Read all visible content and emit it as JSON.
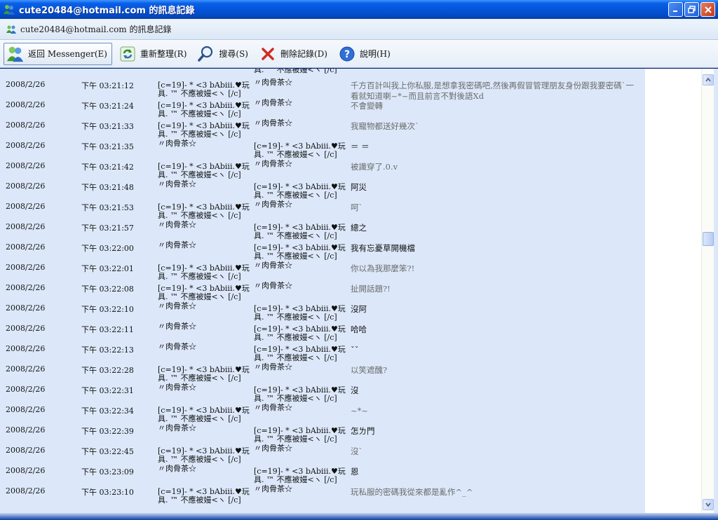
{
  "window": {
    "title": "cute20484@hotmail.com 的訊息記錄",
    "subtitle": "cute20484@hotmail.com 的訊息記錄"
  },
  "toolbar": {
    "back_label": "返回 Messenger(E)",
    "refresh_label": "重新整理(R)",
    "search_label": "搜尋(S)",
    "delete_label": "刪除記錄(D)",
    "help_label": "說明(H)"
  },
  "partial_top": {
    "from": "",
    "to": "具. ™ 不應被嫚<ヽ [/c]"
  },
  "messages": [
    {
      "date": "2008/2/26",
      "time": "下午 03:21:12",
      "from": "[c=19]- * <3 bAbiii.♥玩具. ™ 不應被嫚<ヽ [/c]",
      "to": "〃肉骨茶☆",
      "text": "千方百計叫我上你私服,是想拿我密碼吧,然後再假冒管理朋友身份跟我要密碼`一看就知道喇~*~而且前言不對後語Xd",
      "tone": "gray"
    },
    {
      "date": "2008/2/26",
      "time": "下午 03:21:24",
      "from": "[c=19]- * <3 bAbiii.♥玩具. ™ 不應被嫚<ヽ [/c]",
      "to": "〃肉骨茶☆",
      "text": "不會變轉",
      "tone": "gray"
    },
    {
      "date": "2008/2/26",
      "time": "下午 03:21:33",
      "from": "[c=19]- * <3 bAbiii.♥玩具. ™ 不應被嫚<ヽ [/c]",
      "to": "〃肉骨茶☆",
      "text": "我寵物都送好幾次`",
      "tone": "gray"
    },
    {
      "date": "2008/2/26",
      "time": "下午 03:21:35",
      "from": "〃肉骨茶☆",
      "to": "[c=19]- * <3 bAbiii.♥玩具. ™ 不應被嫚<ヽ [/c]",
      "text": "＝ ＝",
      "tone": "dark"
    },
    {
      "date": "2008/2/26",
      "time": "下午 03:21:42",
      "from": "[c=19]- * <3 bAbiii.♥玩具. ™ 不應被嫚<ヽ [/c]",
      "to": "〃肉骨茶☆",
      "text": "被識穿了.0.v",
      "tone": "gray"
    },
    {
      "date": "2008/2/26",
      "time": "下午 03:21:48",
      "from": "〃肉骨茶☆",
      "to": "[c=19]- * <3 bAbiii.♥玩具. ™ 不應被嫚<ヽ [/c]",
      "text": "阿災",
      "tone": "dark"
    },
    {
      "date": "2008/2/26",
      "time": "下午 03:21:53",
      "from": "[c=19]- * <3 bAbiii.♥玩具. ™ 不應被嫚<ヽ [/c]",
      "to": "〃肉骨茶☆",
      "text": "呵`",
      "tone": "gray"
    },
    {
      "date": "2008/2/26",
      "time": "下午 03:21:57",
      "from": "〃肉骨茶☆",
      "to": "[c=19]- * <3 bAbiii.♥玩具. ™ 不應被嫚<ヽ [/c]",
      "text": "總之",
      "tone": "dark"
    },
    {
      "date": "2008/2/26",
      "time": "下午 03:22:00",
      "from": "〃肉骨茶☆",
      "to": "[c=19]- * <3 bAbiii.♥玩具. ™ 不應被嫚<ヽ [/c]",
      "text": "我有忘憂草開機檔",
      "tone": "dark"
    },
    {
      "date": "2008/2/26",
      "time": "下午 03:22:01",
      "from": "[c=19]- * <3 bAbiii.♥玩具. ™ 不應被嫚<ヽ [/c]",
      "to": "〃肉骨茶☆",
      "text": "你以為我那麼笨?!",
      "tone": "gray"
    },
    {
      "date": "2008/2/26",
      "time": "下午 03:22:08",
      "from": "[c=19]- * <3 bAbiii.♥玩具. ™ 不應被嫚<ヽ [/c]",
      "to": "〃肉骨茶☆",
      "text": "扯開話題?!",
      "tone": "gray"
    },
    {
      "date": "2008/2/26",
      "time": "下午 03:22:10",
      "from": "〃肉骨茶☆",
      "to": "[c=19]- * <3 bAbiii.♥玩具. ™ 不應被嫚<ヽ [/c]",
      "text": "沒阿",
      "tone": "dark"
    },
    {
      "date": "2008/2/26",
      "time": "下午 03:22:11",
      "from": "〃肉骨茶☆",
      "to": "[c=19]- * <3 bAbiii.♥玩具. ™ 不應被嫚<ヽ [/c]",
      "text": "哈哈",
      "tone": "dark"
    },
    {
      "date": "2008/2/26",
      "time": "下午 03:22:13",
      "from": "〃肉骨茶☆",
      "to": "[c=19]- * <3 bAbiii.♥玩具. ™ 不應被嫚<ヽ [/c]",
      "text": "ˇˇ",
      "tone": "dark"
    },
    {
      "date": "2008/2/26",
      "time": "下午 03:22:28",
      "from": "[c=19]- * <3 bAbiii.♥玩具. ™ 不應被嫚<ヽ [/c]",
      "to": "〃肉骨茶☆",
      "text": "以笑遮醜?",
      "tone": "gray"
    },
    {
      "date": "2008/2/26",
      "time": "下午 03:22:31",
      "from": "〃肉骨茶☆",
      "to": "[c=19]- * <3 bAbiii.♥玩具. ™ 不應被嫚<ヽ [/c]",
      "text": "沒",
      "tone": "dark"
    },
    {
      "date": "2008/2/26",
      "time": "下午 03:22:34",
      "from": "[c=19]- * <3 bAbiii.♥玩具. ™ 不應被嫚<ヽ [/c]",
      "to": "〃肉骨茶☆",
      "text": "~*~",
      "tone": "gray"
    },
    {
      "date": "2008/2/26",
      "time": "下午 03:22:39",
      "from": "〃肉骨茶☆",
      "to": "[c=19]- * <3 bAbiii.♥玩具. ™ 不應被嫚<ヽ [/c]",
      "text": "怎ㄌ門",
      "tone": "dark"
    },
    {
      "date": "2008/2/26",
      "time": "下午 03:22:45",
      "from": "[c=19]- * <3 bAbiii.♥玩具. ™ 不應被嫚<ヽ [/c]",
      "to": "〃肉骨茶☆",
      "text": "沒`",
      "tone": "gray"
    },
    {
      "date": "2008/2/26",
      "time": "下午 03:23:09",
      "from": "〃肉骨茶☆",
      "to": "[c=19]- * <3 bAbiii.♥玩具. ™ 不應被嫚<ヽ [/c]",
      "text": "恩",
      "tone": "dark"
    },
    {
      "date": "2008/2/26",
      "time": "下午 03:23:10",
      "from": "[c=19]- * <3 bAbiii.♥玩具. ™ 不應被嫚<ヽ [/c]",
      "to": "〃肉骨茶☆",
      "text": "玩私服的密碼我從來都是亂作^_^",
      "tone": "gray"
    }
  ]
}
